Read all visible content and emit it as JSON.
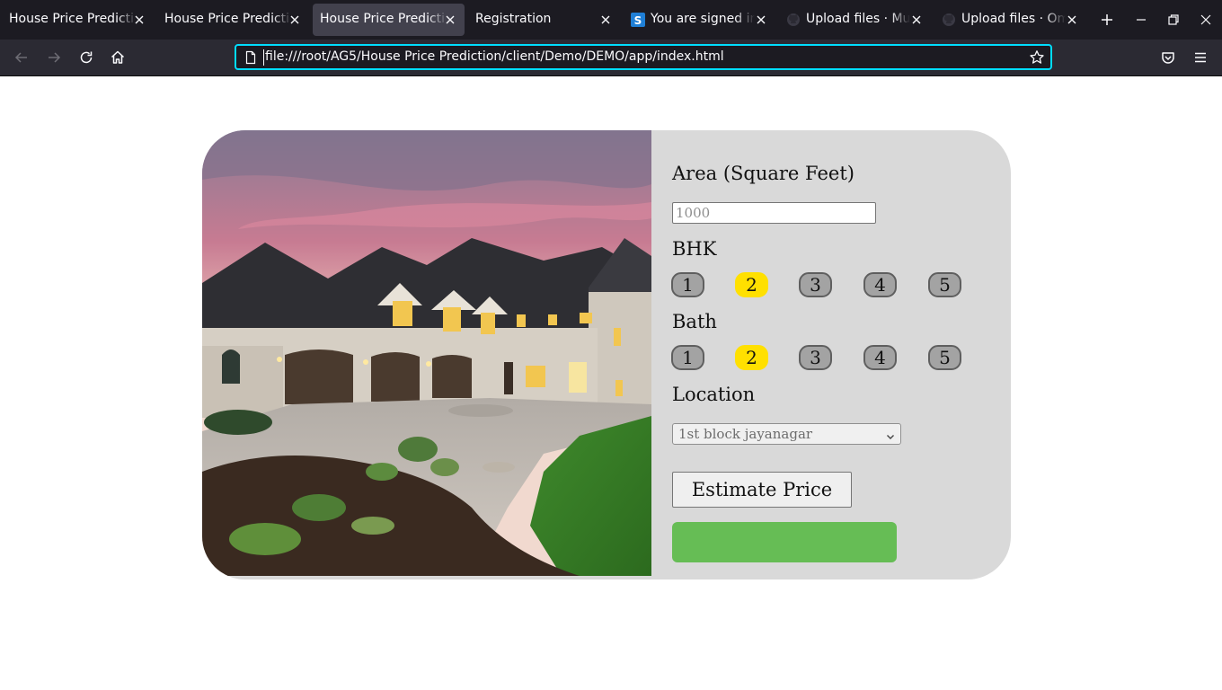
{
  "browser": {
    "tabs": [
      {
        "title": "House Price Prediction",
        "active": false,
        "favicon": "none"
      },
      {
        "title": "House Price Prediction",
        "active": false,
        "favicon": "none"
      },
      {
        "title": "House Price Prediction",
        "active": true,
        "favicon": "none"
      },
      {
        "title": "Registration",
        "active": false,
        "favicon": "none"
      },
      {
        "title": "You are signed in ",
        "active": false,
        "favicon": "s-logo-icon"
      },
      {
        "title": "Upload files · Mud",
        "active": false,
        "favicon": "github-icon"
      },
      {
        "title": "Upload files · OmS",
        "active": false,
        "favicon": "github-icon"
      }
    ],
    "url": "file:///root/AG5/House Price Prediction/client/Demo/DEMO/app/index.html"
  },
  "form": {
    "area_label": "Area (Square Feet)",
    "area_placeholder": "1000",
    "area_value": "",
    "bhk_label": "BHK",
    "bhk_options": [
      "1",
      "2",
      "3",
      "4",
      "5"
    ],
    "bhk_selected": "2",
    "bath_label": "Bath",
    "bath_options": [
      "1",
      "2",
      "3",
      "4",
      "5"
    ],
    "bath_selected": "2",
    "location_label": "Location",
    "location_selected": "1st block jayanagar",
    "estimate_label": "Estimate Price",
    "result_text": ""
  },
  "colors": {
    "selected_pill": "#ffe000",
    "result_box": "#66bd55",
    "card_bg": "#d9d9d9",
    "urlbar_focus": "#00ddff"
  }
}
